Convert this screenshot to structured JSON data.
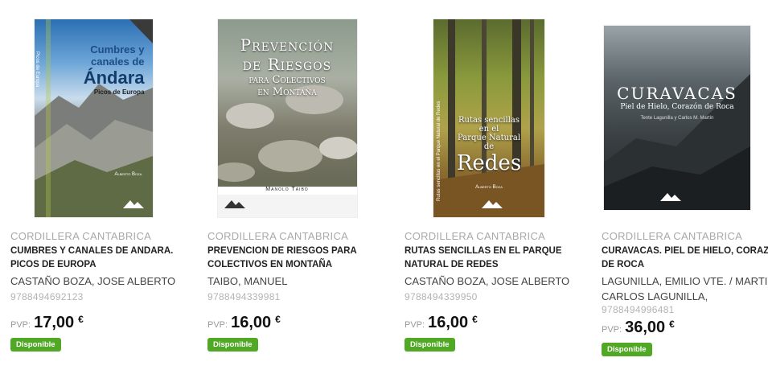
{
  "products": [
    {
      "publisher": "CORDILLERA CANTABRICA",
      "title": "CUMBRES Y CANALES DE ANDARA. PICOS DE EUROPA",
      "author": "CASTAÑO BOZA, JOSE ALBERTO",
      "isbn": "9788494692123",
      "pvp_label": "PVP:",
      "price": "17,00",
      "currency": "€",
      "availability": "Disponible",
      "cover": {
        "line1": "Cumbres y",
        "line2": "canales de",
        "line3": "Ándara",
        "subtitle": "Picos de Europa",
        "spine_tag": "Picos de Europa",
        "author": "Alberto Boza"
      }
    },
    {
      "publisher": "CORDILLERA CANTABRICA",
      "title": "PREVENCION DE RIESGOS PARA COLECTIVOS EN MONTAÑA",
      "author": "TAIBO, MANUEL",
      "isbn": "9788494339981",
      "pvp_label": "PVP:",
      "price": "16,00",
      "currency": "€",
      "availability": "Disponible",
      "cover": {
        "line1": "Prevención",
        "line2": "de Riesgos",
        "line3": "para Colectivos",
        "line4": "en Montaña",
        "author": "Manolo Taibo"
      }
    },
    {
      "publisher": "CORDILLERA CANTABRICA",
      "title": "RUTAS SENCILLAS EN EL PARQUE NATURAL DE REDES",
      "author": "CASTAÑO BOZA, JOSE ALBERTO",
      "isbn": "9788494339950",
      "pvp_label": "PVP:",
      "price": "16,00",
      "currency": "€",
      "availability": "Disponible",
      "cover": {
        "line1": "Rutas sencillas",
        "line2": "en el",
        "line3": "Parque Natural",
        "line4": "de",
        "line5": "Redes",
        "spine": "Rutas sencillas en el Parque Natural de Redes",
        "author": "Alberto Boza"
      }
    },
    {
      "publisher": "CORDILLERA CANTABRICA",
      "title": "CURAVACAS. PIEL DE HIELO, CORAZON DE ROCA",
      "author": "LAGUNILLA, EMILIO VTE. / MARTIN, CARLOS LAGUNILLA,",
      "isbn": "9788494996481",
      "pvp_label": "PVP:",
      "price": "36,00",
      "currency": "€",
      "availability": "Disponible",
      "cover": {
        "line1": "Curavacas",
        "line2": "Piel de Hielo, Corazón de Roca",
        "author": "Tente Lagunilla y Carlos M. Martín"
      }
    }
  ],
  "colors": {
    "badge": "#51a825",
    "publisher": "#a9a9a9"
  }
}
